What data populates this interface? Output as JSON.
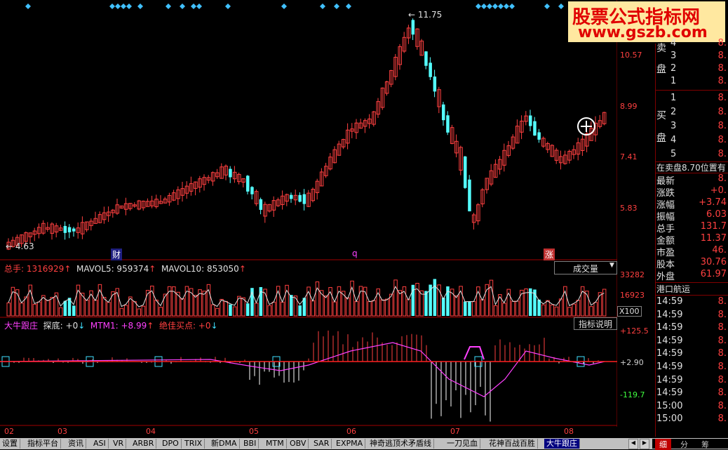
{
  "price_axis": {
    "labels": [
      "10.57",
      "8.99",
      "7.41",
      "5.83"
    ]
  },
  "annotations": {
    "high": "11.75",
    "low": "4.63",
    "marker_left": "财",
    "marker_mid": "q",
    "marker_right": "涨"
  },
  "volume_panel": {
    "title": "总手: 1316929",
    "mavol5": "MAVOL5: 959374",
    "mavol10": "MAVOL10: 853050",
    "dropdown": "成交量",
    "axis": [
      "33282",
      "16923"
    ],
    "unit": "X100"
  },
  "indicator_panel": {
    "name": "大牛跟庄",
    "probe": "探底: +0",
    "mtm": "MTM1: +8.99",
    "best": "绝佳买点: +0",
    "button": "指标说明",
    "axis": [
      "+125.5",
      "+2.90",
      "-119.7"
    ]
  },
  "date_axis": [
    "02",
    "03",
    "04",
    "05",
    "06",
    "07",
    "08"
  ],
  "watermark": {
    "line1": "股票公式指标网",
    "line2": "www.gszb.com"
  },
  "side_panel": {
    "sell": [
      {
        "n": "4",
        "v": "8."
      },
      {
        "n": "3",
        "v": "8."
      },
      {
        "n": "2",
        "v": "8."
      },
      {
        "n": "1",
        "v": "8."
      }
    ],
    "sell_label": [
      "卖",
      "盘"
    ],
    "buy": [
      {
        "n": "1",
        "v": "8."
      },
      {
        "n": "2",
        "v": "8."
      },
      {
        "n": "3",
        "v": "8."
      },
      {
        "n": "4",
        "v": "8."
      },
      {
        "n": "5",
        "v": "8."
      }
    ],
    "buy_label": [
      "买",
      "盘"
    ],
    "notice": "在卖盘8.70位置有",
    "stats": [
      {
        "k": "最新",
        "v": "8."
      },
      {
        "k": "涨跌",
        "v": "+0."
      },
      {
        "k": "涨幅",
        "v": "+3.74"
      },
      {
        "k": "振幅",
        "v": "6.03"
      },
      {
        "k": "总手",
        "v": "131.7"
      },
      {
        "k": "金额",
        "v": "11.37"
      },
      {
        "k": "市盈",
        "v": "46."
      },
      {
        "k": "股本",
        "v": "30.76"
      },
      {
        "k": "外盘",
        "v": "61.97"
      }
    ],
    "name": "港口航运",
    "ticks": [
      {
        "t": "14:59",
        "v": "8."
      },
      {
        "t": "14:59",
        "v": "8."
      },
      {
        "t": "14:59",
        "v": "8."
      },
      {
        "t": "14:59",
        "v": "8."
      },
      {
        "t": "14:59",
        "v": "8."
      },
      {
        "t": "14:59",
        "v": "8."
      },
      {
        "t": "14:59",
        "v": "8."
      },
      {
        "t": "14:59",
        "v": "8."
      },
      {
        "t": "15:00",
        "v": "8."
      },
      {
        "t": "15:00",
        "v": "8."
      }
    ]
  },
  "tabs": [
    "设置",
    "指标平台",
    "资讯",
    "ASI",
    "VR",
    "ARBR",
    "DPO",
    "TRIX",
    "新DMA",
    "BBI",
    "MTM",
    "OBV",
    "SAR",
    "EXPMA",
    "神奇逃顶术矛盾线",
    "一刀见血",
    "花神百战百胜",
    "大牛跟庄"
  ],
  "right_tabs": [
    "细",
    "分",
    "筹"
  ],
  "colors": {
    "up": "#ff4040",
    "down": "#54ffff",
    "background": "#000000",
    "grid": "#800000"
  }
}
